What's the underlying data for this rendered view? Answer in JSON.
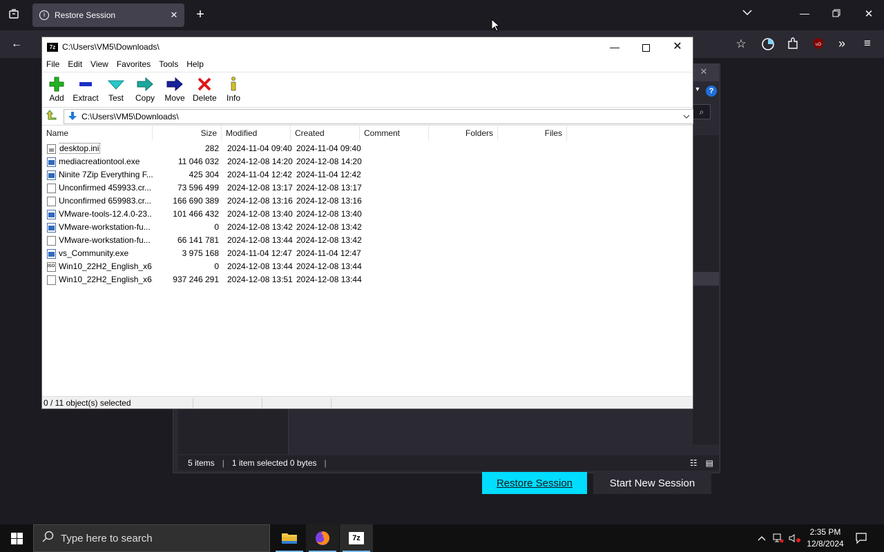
{
  "browser": {
    "tab_title": "Restore Session",
    "restore_label": "Restore Session",
    "new_session_label": "Start New Session",
    "status_items": "5 items",
    "status_selected": "1 item selected  0 bytes"
  },
  "zip": {
    "title": "C:\\Users\\VM5\\Downloads\\",
    "menu": [
      "File",
      "Edit",
      "View",
      "Favorites",
      "Tools",
      "Help"
    ],
    "toolbar": [
      "Add",
      "Extract",
      "Test",
      "Copy",
      "Move",
      "Delete",
      "Info"
    ],
    "address": "C:\\Users\\VM5\\Downloads\\",
    "columns": [
      "Name",
      "Size",
      "Modified",
      "Created",
      "Comment",
      "Folders",
      "Files"
    ],
    "files": [
      {
        "icon": "ini-file-icon",
        "name": "desktop.ini",
        "size": "282",
        "modified": "2024-11-04 09:40",
        "created": "2024-11-04 09:40"
      },
      {
        "icon": "exe-file-icon",
        "name": "mediacreationtool.exe",
        "size": "11 046 032",
        "modified": "2024-12-08 14:20",
        "created": "2024-12-08 14:20"
      },
      {
        "icon": "exe-file-icon",
        "name": "Ninite 7Zip Everything F...",
        "size": "425 304",
        "modified": "2024-11-04 12:42",
        "created": "2024-11-04 12:42"
      },
      {
        "icon": "file-icon",
        "name": "Unconfirmed 459933.cr...",
        "size": "73 596 499",
        "modified": "2024-12-08 13:17",
        "created": "2024-12-08 13:17"
      },
      {
        "icon": "file-icon",
        "name": "Unconfirmed 659983.cr...",
        "size": "166 690 389",
        "modified": "2024-12-08 13:16",
        "created": "2024-12-08 13:16"
      },
      {
        "icon": "exe-file-icon",
        "name": "VMware-tools-12.4.0-23...",
        "size": "101 466 432",
        "modified": "2024-12-08 13:40",
        "created": "2024-12-08 13:40"
      },
      {
        "icon": "exe-file-icon",
        "name": "VMware-workstation-fu...",
        "size": "0",
        "modified": "2024-12-08 13:42",
        "created": "2024-12-08 13:42"
      },
      {
        "icon": "file-icon",
        "name": "VMware-workstation-fu...",
        "size": "66 141 781",
        "modified": "2024-12-08 13:44",
        "created": "2024-12-08 13:42"
      },
      {
        "icon": "exe-file-icon",
        "name": "vs_Community.exe",
        "size": "3 975 168",
        "modified": "2024-11-04 12:47",
        "created": "2024-11-04 12:47"
      },
      {
        "icon": "iso-file-icon",
        "name": "Win10_22H2_English_x6...",
        "size": "0",
        "modified": "2024-12-08 13:44",
        "created": "2024-12-08 13:44"
      },
      {
        "icon": "file-icon",
        "name": "Win10_22H2_English_x6...",
        "size": "937 246 291",
        "modified": "2024-12-08 13:51",
        "created": "2024-12-08 13:44"
      }
    ],
    "status": "0 / 11 object(s) selected"
  },
  "taskbar": {
    "search_placeholder": "Type here to search",
    "time": "2:35 PM",
    "date": "12/8/2024"
  }
}
